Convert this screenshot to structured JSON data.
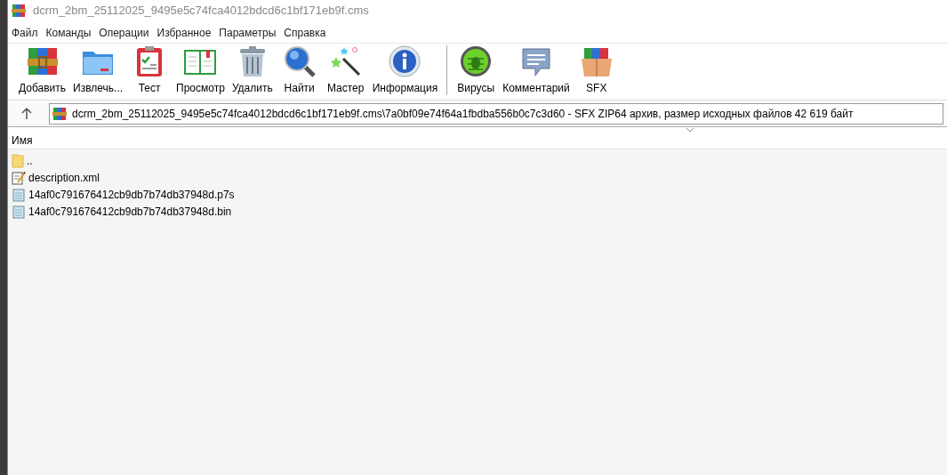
{
  "window": {
    "title": "dcrm_2bm_25112025_9495e5c74fca4012bdcd6c1bf171eb9f.cms"
  },
  "menu": [
    "Файл",
    "Команды",
    "Операции",
    "Избранное",
    "Параметры",
    "Справка"
  ],
  "toolbar": [
    {
      "kind": "add",
      "label": "Добавить"
    },
    {
      "kind": "extract",
      "label": "Извлечь..."
    },
    {
      "kind": "test",
      "label": "Тест"
    },
    {
      "kind": "view",
      "label": "Просмотр"
    },
    {
      "kind": "delete",
      "label": "Удалить"
    },
    {
      "kind": "find",
      "label": "Найти"
    },
    {
      "kind": "wizard",
      "label": "Мастер"
    },
    {
      "kind": "info",
      "label": "Информация"
    },
    {
      "kind": "separator"
    },
    {
      "kind": "virus",
      "label": "Вирусы"
    },
    {
      "kind": "comment",
      "label": "Комментарий"
    },
    {
      "kind": "sfx",
      "label": "SFX"
    }
  ],
  "address": {
    "path": "dcrm_2bm_25112025_9495e5c74fca4012bdcd6c1bf171eb9f.cms\\7a0bf09e74f64a1fbdba556b0c7c3d60 - SFX ZIP64 архив, размер исходных файлов 42 619 байт"
  },
  "file_list": {
    "columns": [
      "Имя"
    ],
    "rows": [
      {
        "kind": "folder",
        "name": ".."
      },
      {
        "kind": "xml",
        "name": "description.xml"
      },
      {
        "kind": "file",
        "name": "14af0c791676412cb9db7b74db37948d.p7s"
      },
      {
        "kind": "file",
        "name": "14af0c791676412cb9db7b74db37948d.bin"
      }
    ]
  }
}
